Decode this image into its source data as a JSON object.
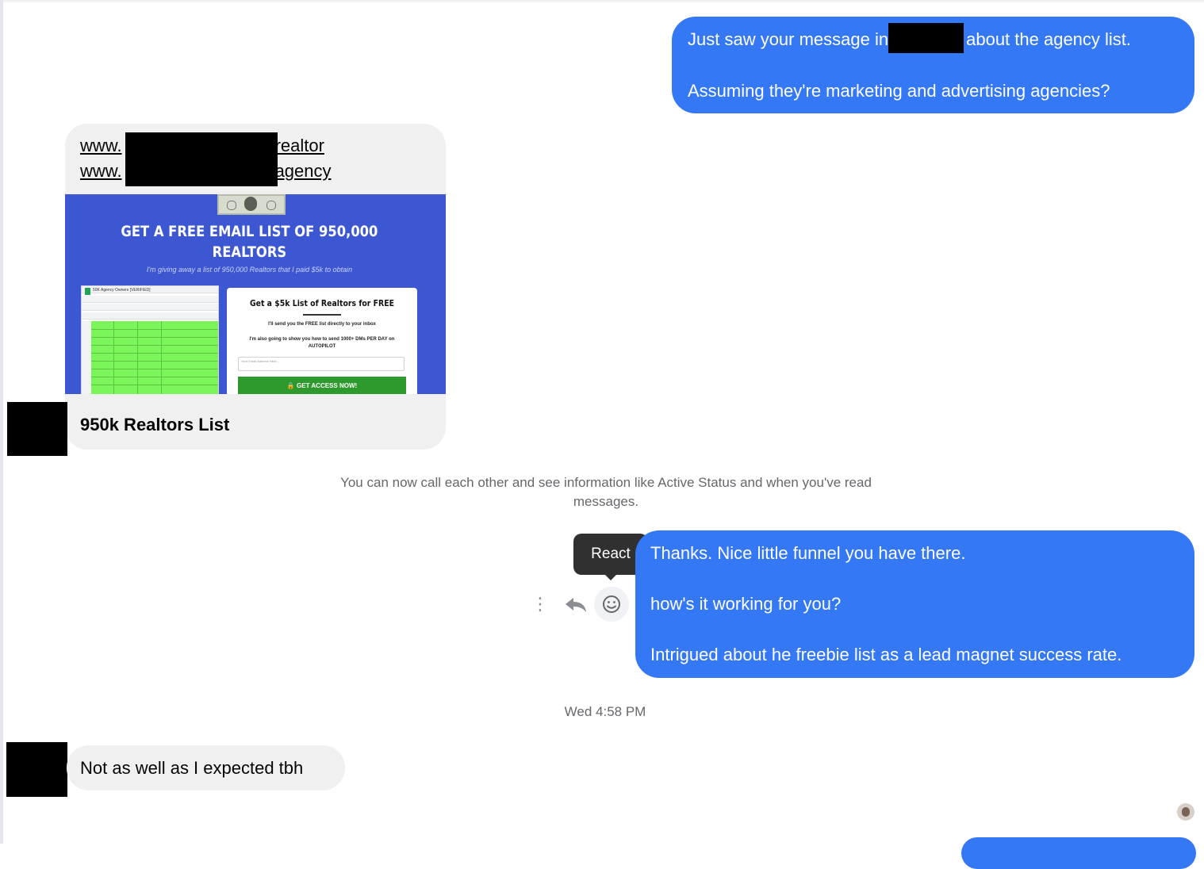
{
  "messages": {
    "m1": {
      "line1_before": "Just saw your message in",
      "line1_after": "about the agency list.",
      "line2": "Assuming they're marketing and advertising agencies?"
    },
    "link_card": {
      "url1_prefix": "www.",
      "url1_suffix": "realtor",
      "url2_prefix": "www.",
      "url2_suffix": "agency",
      "preview_headline": "GET A FREE EMAIL LIST OF 950,000 REALTORS",
      "preview_subtext": "I'm giving away a list of 950,000 Realtors that I paid $5k to obtain",
      "sheet_title": "50K Agency Owners [VERIFIED]",
      "form_title": "Get a $5k List of Realtors for FREE",
      "form_line1": "I'll send you the FREE list directly to your inbox",
      "form_line2": "I'm also going to show you how to send 1000+ DMs PER DAY on AUTOPILOT",
      "form_email_placeholder": "Your Email Address Here...",
      "form_button": "GET ACCESS NOW!",
      "title": "950k Realtors List"
    },
    "system_note": "You can now call each other and see information like Active Status and when you've read messages.",
    "m3": {
      "line1": "Thanks. Nice little funnel you have there.",
      "line2": "how's it working for you?",
      "line3": "Intrigued about he freebie list as a lead magnet success rate."
    },
    "timestamp": "Wed 4:58 PM",
    "m4": "Not as well as I expected tbh"
  },
  "actions": {
    "tooltip": "React",
    "icons": [
      "more-vertical-icon",
      "reply-icon",
      "smiley-icon"
    ]
  },
  "colors": {
    "outgoing_bubble": "#3478f6",
    "incoming_bubble": "#f0f0f0",
    "tooltip_bg": "#303030",
    "meta_text": "#65676b"
  }
}
